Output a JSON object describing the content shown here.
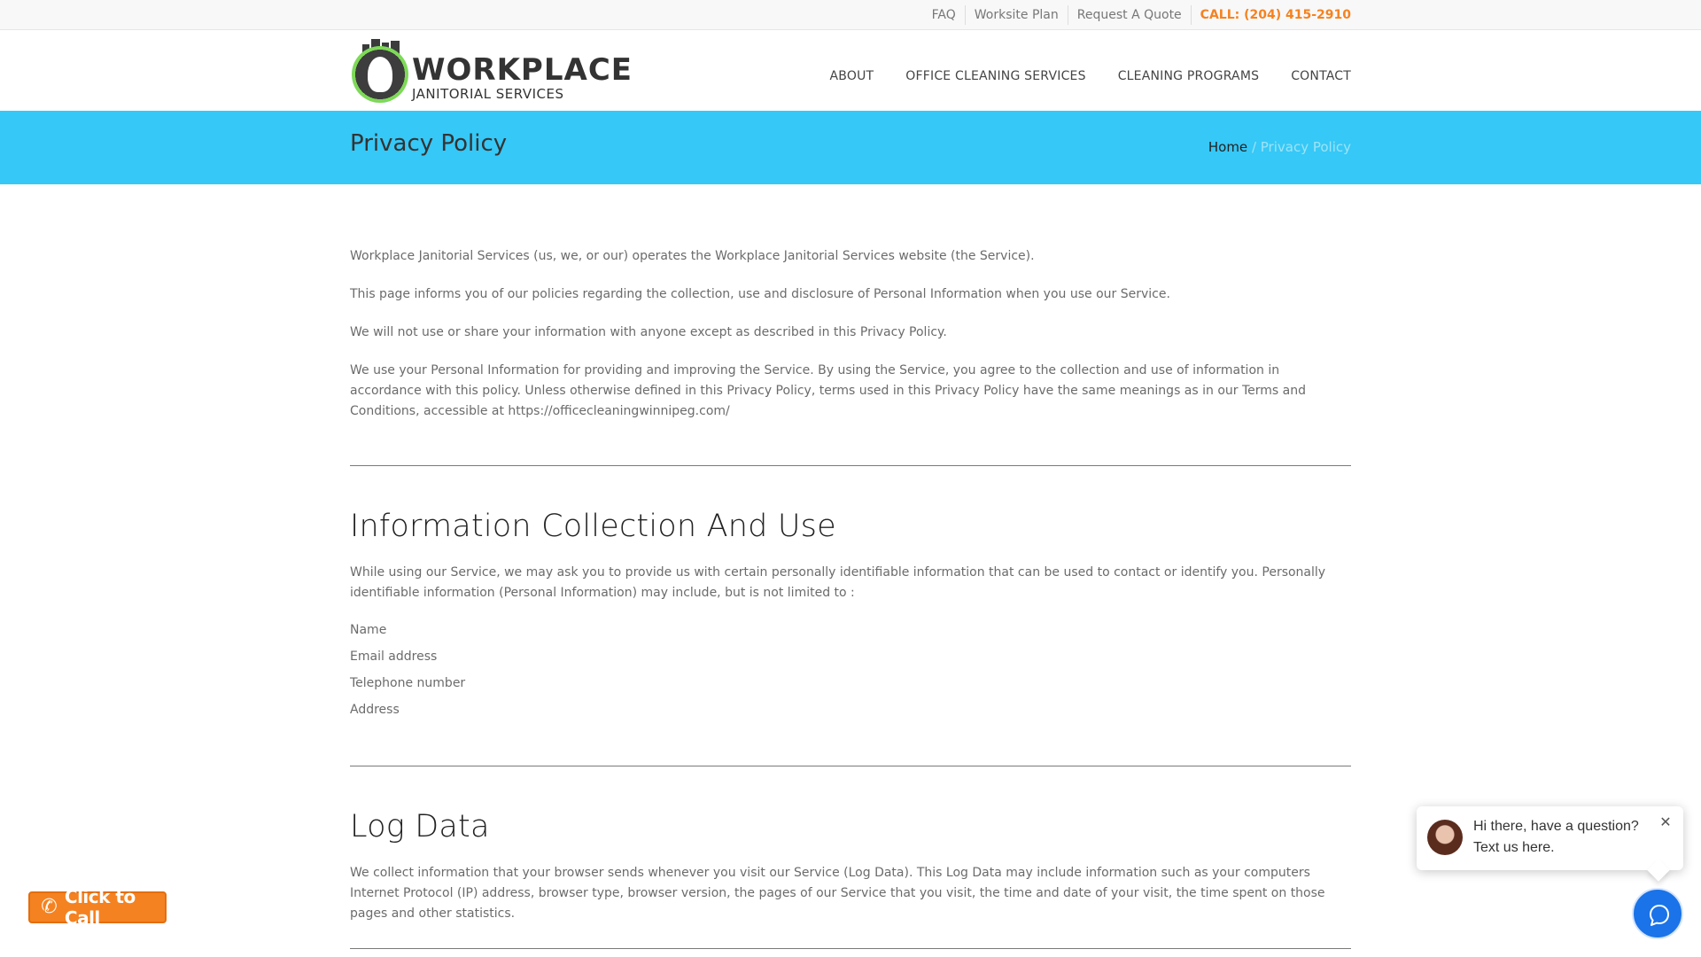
{
  "topbar": {
    "links": [
      "FAQ",
      "Worksite Plan",
      "Request A Quote"
    ],
    "call": "CALL: (204) 415-2910"
  },
  "logo": {
    "line1": "WORKPLACE",
    "line2": "JANITORIAL SERVICES"
  },
  "nav": [
    "ABOUT",
    "OFFICE CLEANING SERVICES",
    "CLEANING PROGRAMS",
    "CONTACT"
  ],
  "page": {
    "title": "Privacy Policy",
    "breadcrumb": {
      "home": "Home",
      "separator": "/",
      "current": "Privacy Policy"
    }
  },
  "intro": [
    "Workplace Janitorial Services (us, we, or our) operates the Workplace Janitorial Services website (the Service).",
    "This page informs you of our policies regarding the collection, use and disclosure of Personal Information when you use our Service.",
    "We will not use or share your information with anyone except as described in this Privacy Policy.",
    "We use your Personal Information for providing and improving the Service. By using the Service, you agree to the collection and use of information in accordance with this policy. Unless otherwise defined in this Privacy Policy, terms used in this Privacy Policy have the same meanings as in our Terms and Conditions, accessible at https://officecleaningwinnipeg.com/"
  ],
  "section1": {
    "heading": "Information Collection And Use",
    "body": "While using our Service, we may ask you to provide us with certain personally identifiable information that can be used to contact or identify you. Personally identifiable information (Personal Information) may include, but is not limited to :",
    "items": [
      "Name",
      "Email address",
      "Telephone number",
      "Address"
    ]
  },
  "section2": {
    "heading": "Log Data",
    "body": "We collect information that your browser sends whenever you visit our Service (Log Data). This Log Data may include information such as your computers Internet Protocol (IP) address, browser type, browser version, the pages of our Service that you visit, the time and date of your visit, the time spent on those pages and other statistics."
  },
  "click_to_call": {
    "label": "Click to Call",
    "icon": "phone-icon"
  },
  "chat": {
    "line1": "Hi there, have a question?",
    "line2": "Text us here.",
    "close_icon": "close-icon",
    "button_icon": "chat-bubble-icon"
  },
  "colors": {
    "accent_orange": "#f58220",
    "title_bar": "#36c8f6",
    "chat_button": "#1a73e8"
  }
}
